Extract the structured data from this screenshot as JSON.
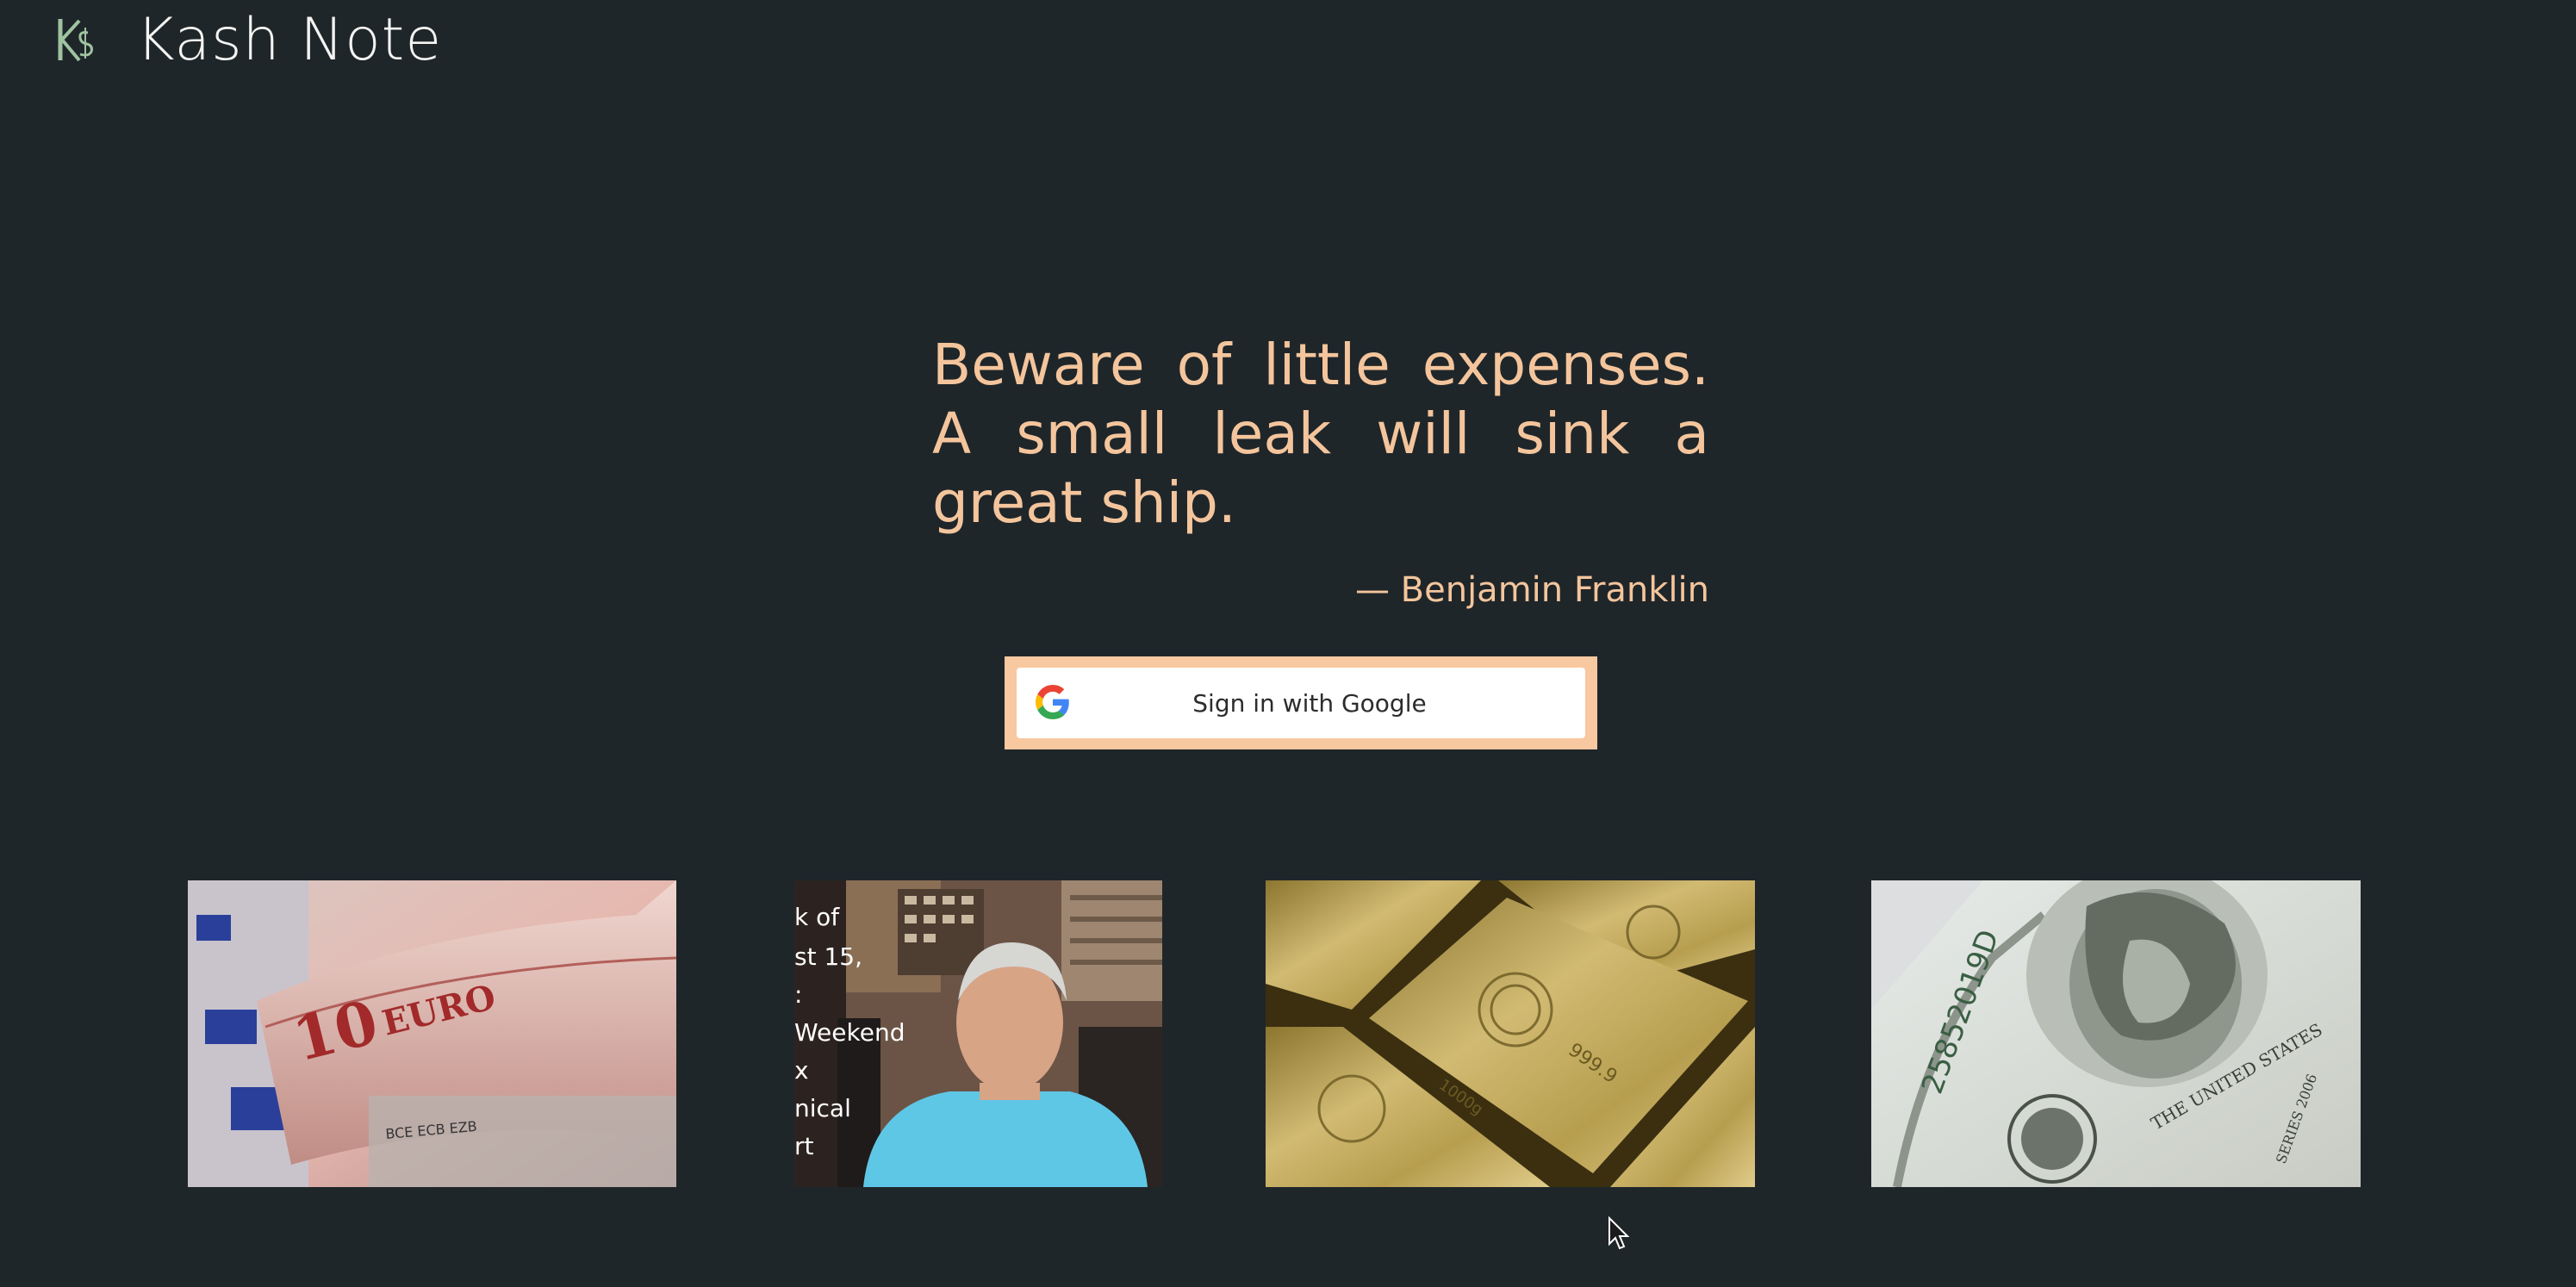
{
  "app": {
    "title": "Kash Note",
    "logo_icon": "ks-logo-icon"
  },
  "quote": {
    "text": "Beware of little expenses. A small leak will sink a great ship.",
    "author": "— Benjamin Franklin"
  },
  "signin": {
    "label": "Sign in with Google",
    "icon": "google-icon"
  },
  "gallery": {
    "video_overlay_lines": [
      "k of",
      "st 15,",
      ":",
      "Weekend",
      "x",
      "nical",
      "rt"
    ]
  },
  "colors": {
    "background": "#1f262a",
    "accent": "#f4c59c",
    "button_frame": "#f8c8a0",
    "logo": "#9fc3a0"
  }
}
